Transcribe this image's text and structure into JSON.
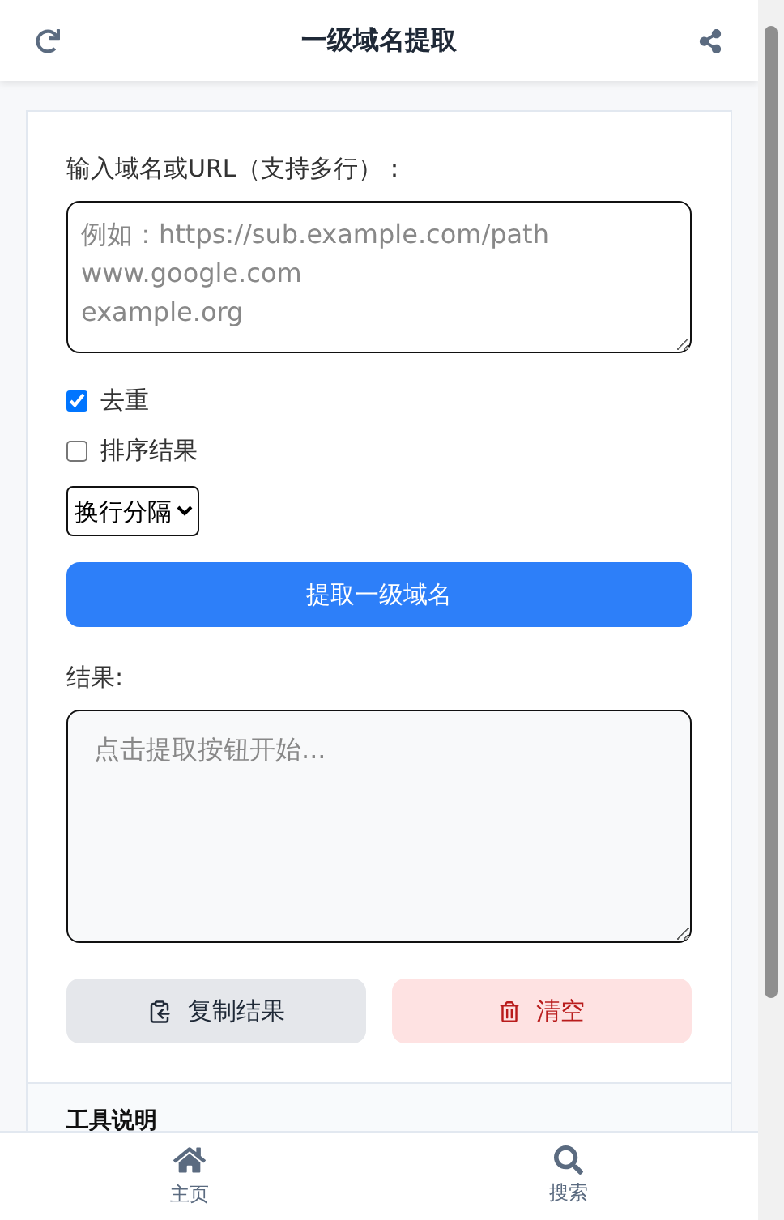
{
  "header": {
    "title": "一级域名提取"
  },
  "input": {
    "label": "输入域名或URL（支持多行）：",
    "placeholder": "例如：https://sub.example.com/path\nwww.google.com\nexample.org"
  },
  "options": [
    {
      "label": "去重",
      "checked": true
    },
    {
      "label": "排序结果",
      "checked": false
    }
  ],
  "separator": {
    "value": "换行分隔"
  },
  "extract_button": "提取一级域名",
  "result": {
    "label": "结果:",
    "placeholder": "点击提取按钮开始..."
  },
  "actions": [
    {
      "kind": "copy",
      "label": "复制结果"
    },
    {
      "kind": "clear",
      "label": "清空"
    }
  ],
  "info": {
    "title": "工具说明"
  },
  "nav": [
    {
      "kind": "home",
      "label": "主页"
    },
    {
      "kind": "search",
      "label": "搜索"
    }
  ]
}
